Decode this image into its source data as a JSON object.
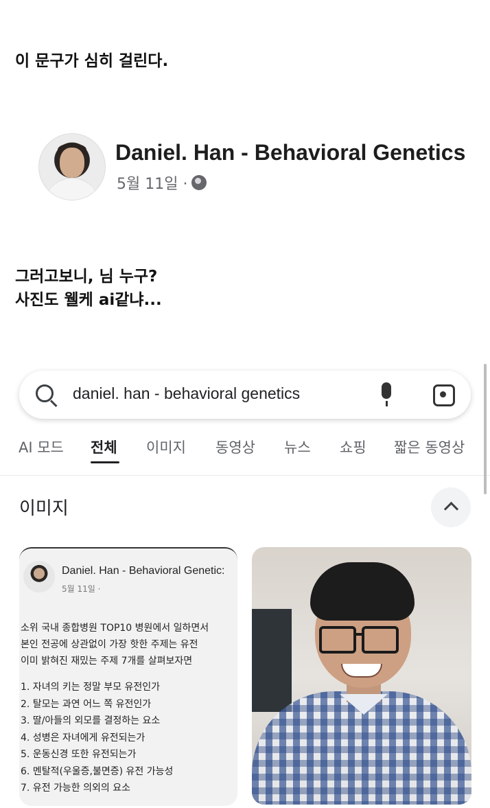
{
  "caption_top": "이 문구가 심히 걸린다.",
  "profile": {
    "name": "Daniel. Han - Behavioral Genetics",
    "date": "5월 11일 ·",
    "globe_icon": "globe-icon"
  },
  "caption_middle": {
    "line1": "그러고보니, 님 누구?",
    "line2": "사진도 웰케 ai같냐..."
  },
  "search": {
    "query": "daniel. han - behavioral genetics",
    "icons": [
      "search-icon",
      "mic-icon",
      "lens-icon"
    ]
  },
  "tabs": [
    {
      "label": "AI 모드",
      "active": false
    },
    {
      "label": "전체",
      "active": true
    },
    {
      "label": "이미지",
      "active": false
    },
    {
      "label": "동영상",
      "active": false
    },
    {
      "label": "뉴스",
      "active": false
    },
    {
      "label": "쇼핑",
      "active": false
    },
    {
      "label": "짧은 동영상",
      "active": false
    }
  ],
  "images_section": {
    "title": "이미지",
    "card1": {
      "name": "Daniel. Han - Behavioral Genetic:",
      "date": "5월 11일 ·",
      "body": [
        "소위 국내 종합병원 TOP10 병원에서 일하면서",
        "본인 전공에 상관없이 가장 핫한 주제는 유전",
        "이미 밝혀진 재밌는 주제 7개를 살펴보자면"
      ],
      "list": [
        "1. 자녀의 키는 정말 부모 유전인가",
        "2. 탈모는 과연 어느 쪽 유전인가",
        "3. 딸/아들의 외모를 결정하는 요소",
        "4. 성병은 자녀에게 유전되는가",
        "5. 운동신경 또한 유전되는가",
        "6. 멘탈적(우울증,불면증) 유전 가능성",
        "7. 유전 가능한 의외의 요소"
      ]
    }
  }
}
